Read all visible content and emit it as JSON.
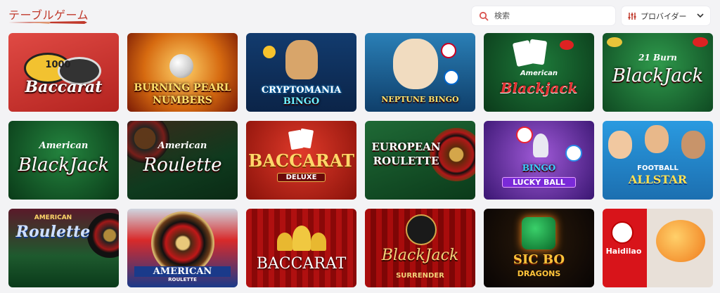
{
  "header": {
    "section_title": "テーブルゲーム",
    "search_placeholder": "検索",
    "provider_label": "プロバイダー"
  },
  "games": [
    {
      "id": "baccarat",
      "title": "Baccarat",
      "chip_text": "1000"
    },
    {
      "id": "burning-pearl-numbers",
      "title": "BURNING PEARL",
      "subtitle": "NUMBERS"
    },
    {
      "id": "cryptomania-bingo",
      "title": "CRYPTOMANIA",
      "subtitle": "BINGO"
    },
    {
      "id": "neptune-bingo",
      "title": "NEPTUNE BINGO"
    },
    {
      "id": "american-blackjack-1",
      "title": "Blackjack",
      "top": "American"
    },
    {
      "id": "21-burn-blackjack",
      "title": "BlackJack",
      "top": "21 Burn"
    },
    {
      "id": "american-blackjack-2",
      "title": "BlackJack",
      "top": "American"
    },
    {
      "id": "american-roulette-1",
      "title": "Roulette",
      "top": "American"
    },
    {
      "id": "baccarat-deluxe",
      "title": "BACCARAT",
      "subtitle": "DELUXE"
    },
    {
      "id": "european-roulette",
      "title": "EUROPEAN",
      "subtitle": "ROULETTE"
    },
    {
      "id": "e-bingo-lucky-ball",
      "title": "LUCKY BALL",
      "subtitle": "BINGO"
    },
    {
      "id": "football-allstar",
      "title": "ALLSTAR",
      "top": "FOOTBALL"
    },
    {
      "id": "american-roulette-2",
      "title": "Roulette",
      "top": "AMERICAN"
    },
    {
      "id": "american-roulette-3",
      "title": "AMERICAN",
      "subtitle": "ROULETTE"
    },
    {
      "id": "baccarat-gold",
      "title": "BACCARAT"
    },
    {
      "id": "blackjack-surrender",
      "title": "BlackJack",
      "subtitle": "SURRENDER"
    },
    {
      "id": "sic-bo-dragons",
      "title": "SIC BO",
      "subtitle": "DRAGONS"
    },
    {
      "id": "haidilao",
      "title": "Haidilao"
    }
  ],
  "colors": {
    "accent": "#c0392b",
    "search_icon": "#d9534f"
  }
}
